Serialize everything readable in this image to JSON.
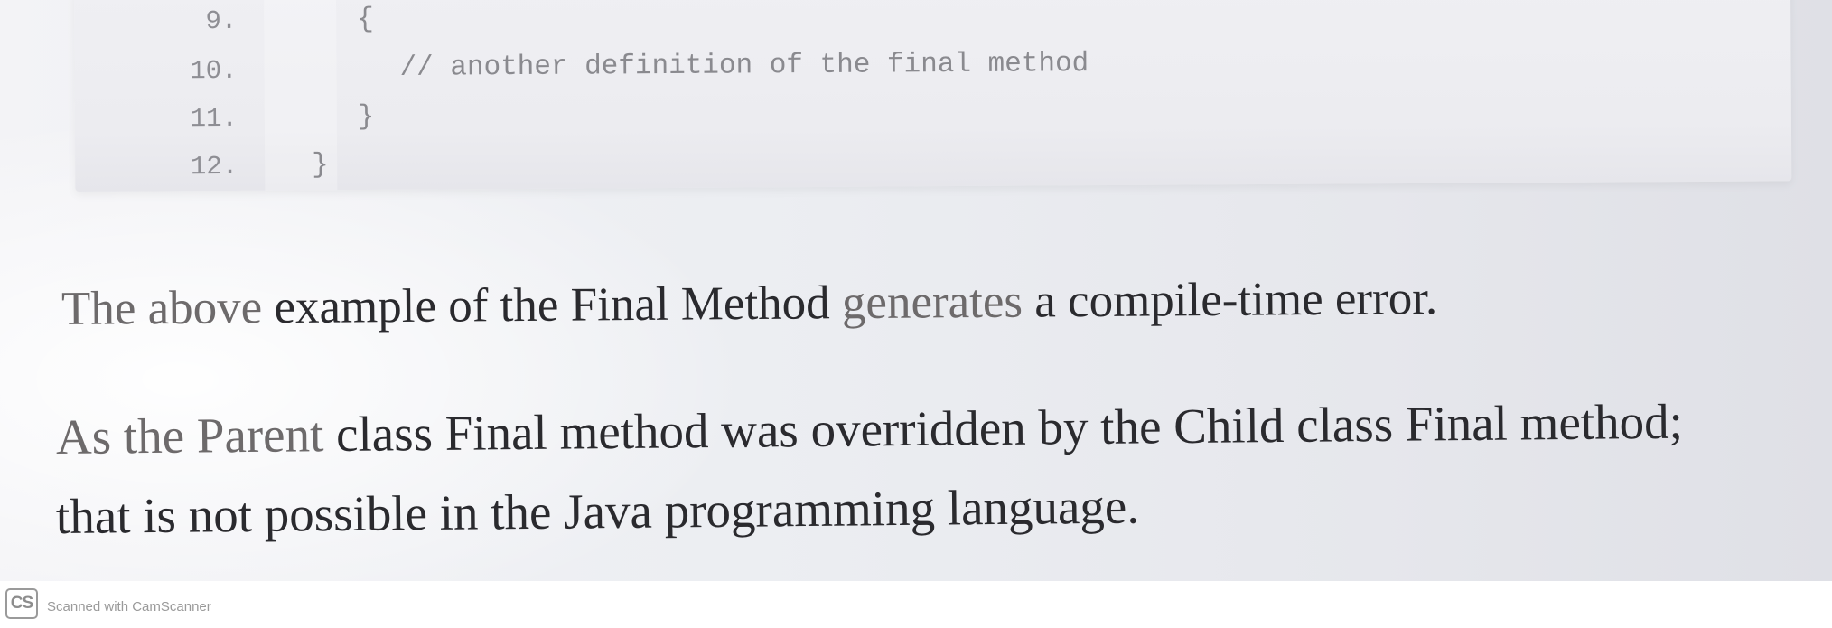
{
  "code": {
    "lines": [
      {
        "num": "9.",
        "text": "{"
      },
      {
        "num": "10.",
        "text": "// another definition of the final method"
      },
      {
        "num": "11.",
        "text": "}"
      },
      {
        "num": "12.",
        "text": "}"
      }
    ]
  },
  "paragraphs": {
    "p1": {
      "faded_part": "The above",
      "main_part": " example of the Final Method ",
      "faded_part_2": "generates",
      "end_part": " a compile-time error."
    },
    "p2": {
      "faded_part": "As the Parent",
      "main_part": " class Final method was overridden by the Child class Final method;"
    },
    "p3": {
      "text": "that is not possible in the Java programming language."
    }
  },
  "footer": {
    "logo_text": "CS",
    "scanner_text": "Scanned with CamScanner"
  }
}
